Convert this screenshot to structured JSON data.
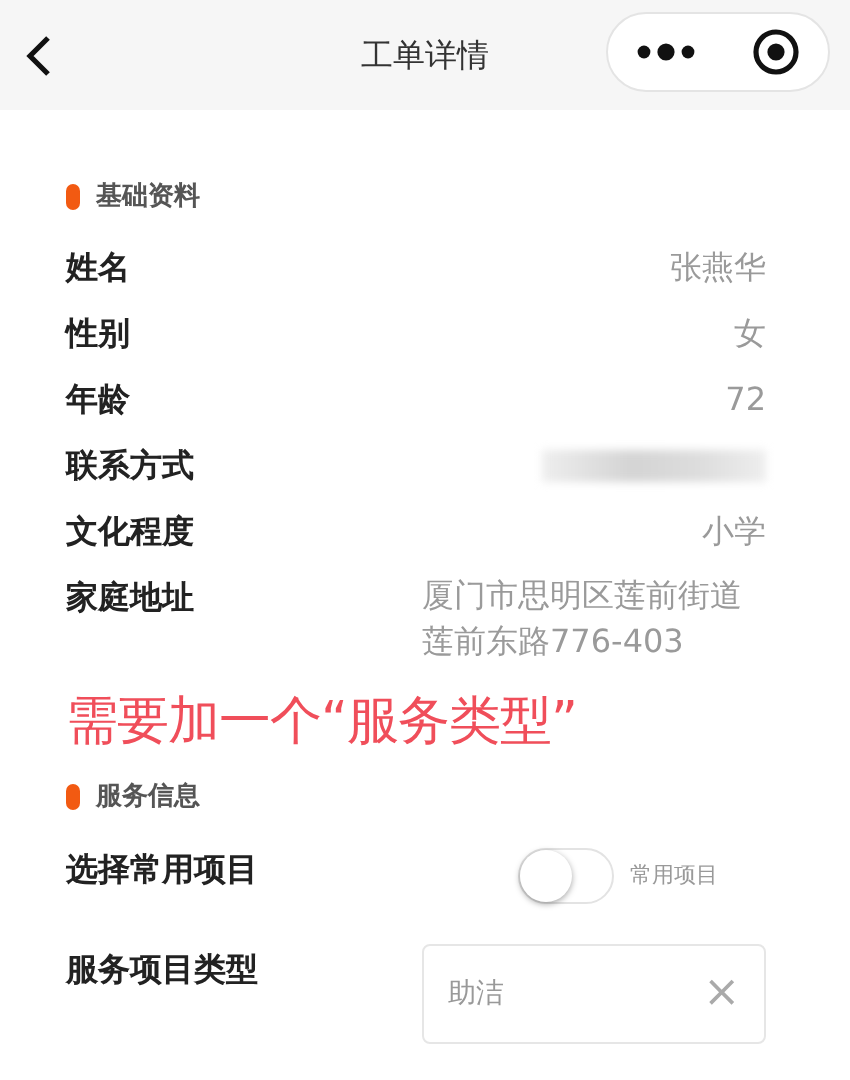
{
  "header": {
    "title": "工单详情"
  },
  "sections": [
    {
      "title": "基础资料",
      "fields": [
        {
          "kind": "text",
          "label": "姓名",
          "value": "张燕华"
        },
        {
          "kind": "text",
          "label": "性别",
          "value": "女"
        },
        {
          "kind": "text",
          "label": "年龄",
          "value": "72"
        },
        {
          "kind": "redacted",
          "label": "联系方式"
        },
        {
          "kind": "text",
          "label": "文化程度",
          "value": "小学"
        },
        {
          "kind": "address",
          "label": "家庭地址",
          "value": "厦门市思明区莲前街道莲前东路776-403"
        }
      ]
    },
    {
      "annotation": "需要加一个“服务类型”",
      "title": "服务信息",
      "fields": [
        {
          "kind": "switch",
          "label": "选择常用项目",
          "on": false,
          "caption": "常用项目"
        },
        {
          "kind": "select",
          "label": "服务项目类型",
          "value": "助洁",
          "clear": "×"
        }
      ]
    }
  ]
}
